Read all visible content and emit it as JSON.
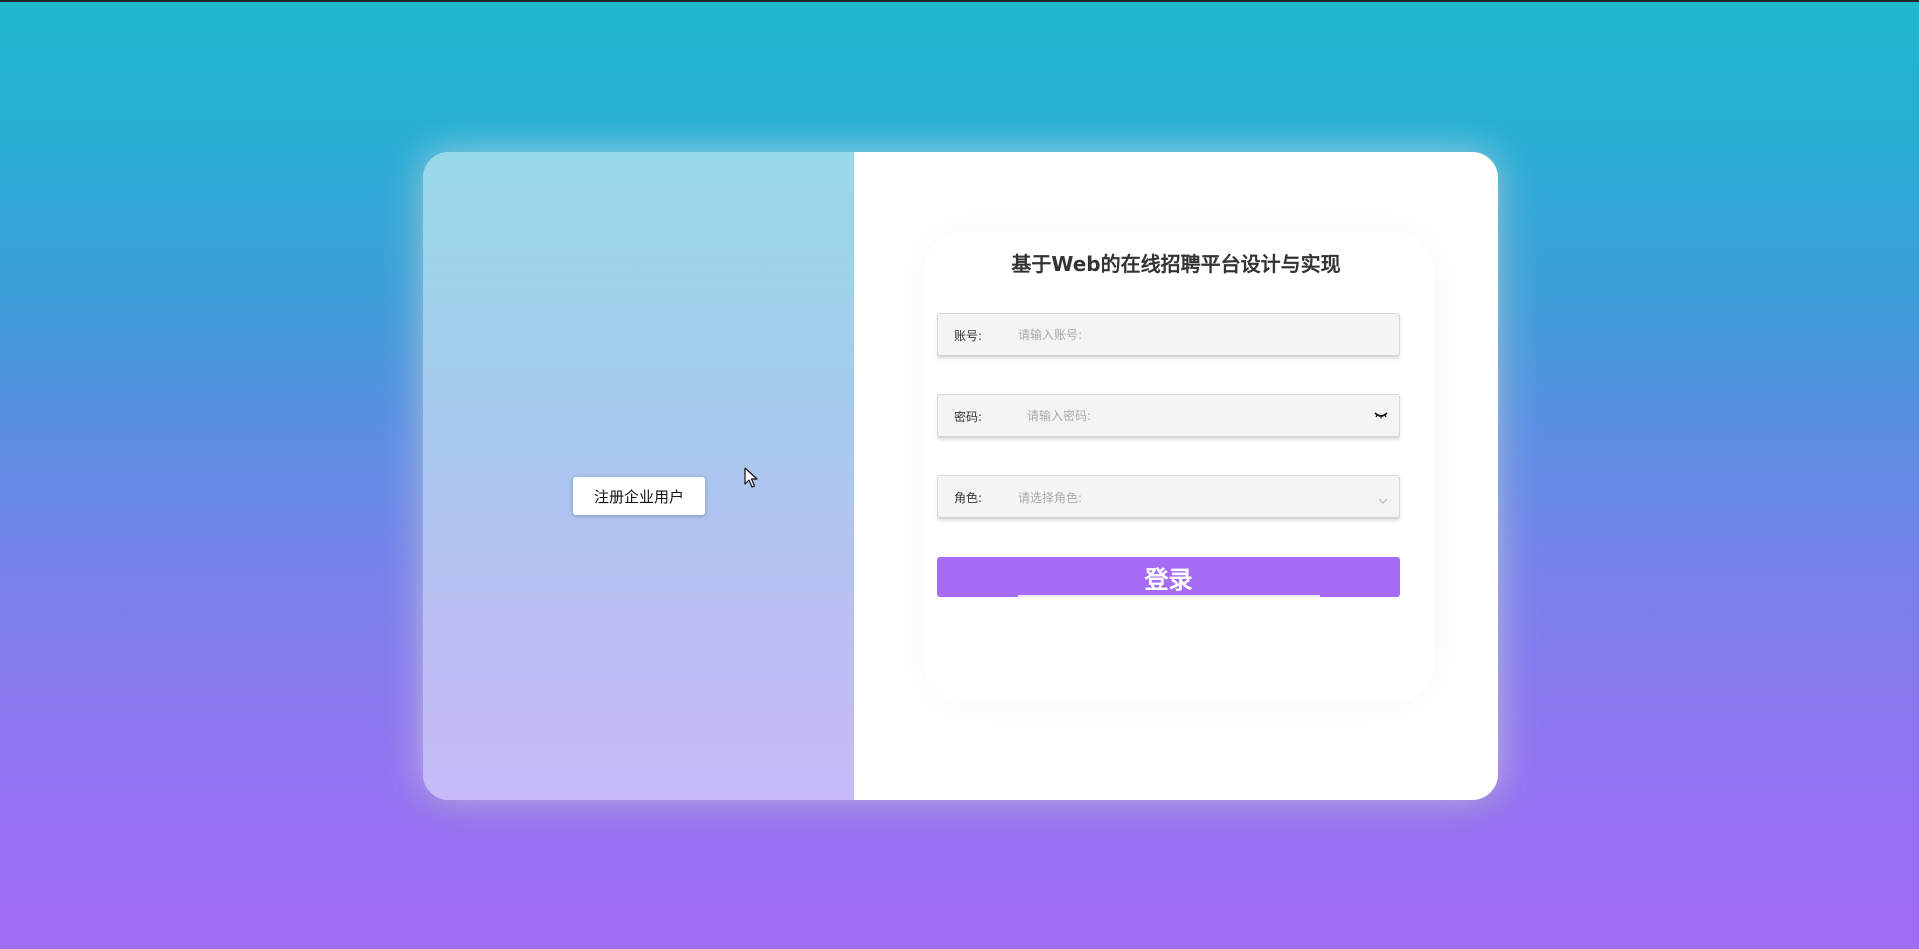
{
  "left_panel": {
    "register_button_label": "注册企业用户"
  },
  "login_form": {
    "title": "基于Web的在线招聘平台设计与实现",
    "account": {
      "label": "账号:",
      "placeholder": "请输入账号:",
      "value": ""
    },
    "password": {
      "label": "密码:",
      "placeholder": "请输入密码:",
      "value": "",
      "toggle_icon": "eye-closed-icon"
    },
    "role": {
      "label": "角色:",
      "placeholder": "请选择角色:",
      "icon": "chevron-down-icon"
    },
    "login_button_label": "登录"
  },
  "colors": {
    "background_top": "#1fb9cf",
    "background_bottom": "#a06cf5",
    "accent": "#a66cf5",
    "left_panel_top": "#97d9e8",
    "left_panel_bottom": "#c6bbf6"
  }
}
